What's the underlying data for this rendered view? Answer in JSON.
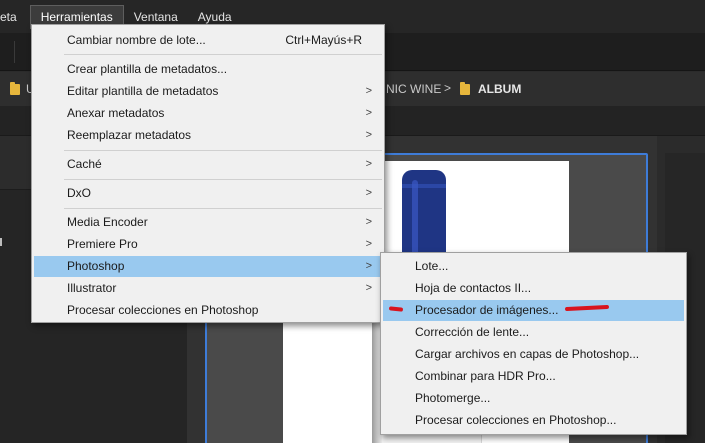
{
  "menubar": {
    "items": [
      {
        "label": "eta"
      },
      {
        "label": "Herramientas"
      },
      {
        "label": "Ventana"
      },
      {
        "label": "Ayuda"
      }
    ]
  },
  "path": {
    "partial_left": "U",
    "partial_middle": "NIC WINE",
    "separator": ">",
    "current": "ALBUM"
  },
  "tools_menu": {
    "items": [
      {
        "label": "Cambiar nombre de lote...",
        "shortcut": "Ctrl+Mayús+R"
      },
      {
        "label": "Crear plantilla de metadatos..."
      },
      {
        "label": "Editar plantilla de metadatos",
        "arrow": ">"
      },
      {
        "label": "Anexar metadatos",
        "arrow": ">"
      },
      {
        "label": "Reemplazar metadatos",
        "arrow": ">"
      },
      {
        "label": "Caché",
        "arrow": ">"
      },
      {
        "label": "DxO",
        "arrow": ">"
      },
      {
        "label": "Media Encoder",
        "arrow": ">"
      },
      {
        "label": "Premiere Pro",
        "arrow": ">"
      },
      {
        "label": "Photoshop",
        "arrow": ">"
      },
      {
        "label": "Illustrator",
        "arrow": ">"
      },
      {
        "label": "Procesar colecciones en Photoshop"
      }
    ]
  },
  "photoshop_submenu": {
    "items": [
      {
        "label": "Lote..."
      },
      {
        "label": "Hoja de contactos II..."
      },
      {
        "label": "Procesador de imágenes..."
      },
      {
        "label": "Corrección de lente..."
      },
      {
        "label": "Cargar archivos en capas de Photoshop..."
      },
      {
        "label": "Combinar para HDR Pro..."
      },
      {
        "label": "Photomerge..."
      },
      {
        "label": "Procesar colecciones en Photoshop..."
      }
    ]
  },
  "colors": {
    "highlight": "#99c9ef",
    "annotation": "#d8141e",
    "selection_border": "#3e7cd8",
    "bottle_cap": "#1f3584"
  }
}
